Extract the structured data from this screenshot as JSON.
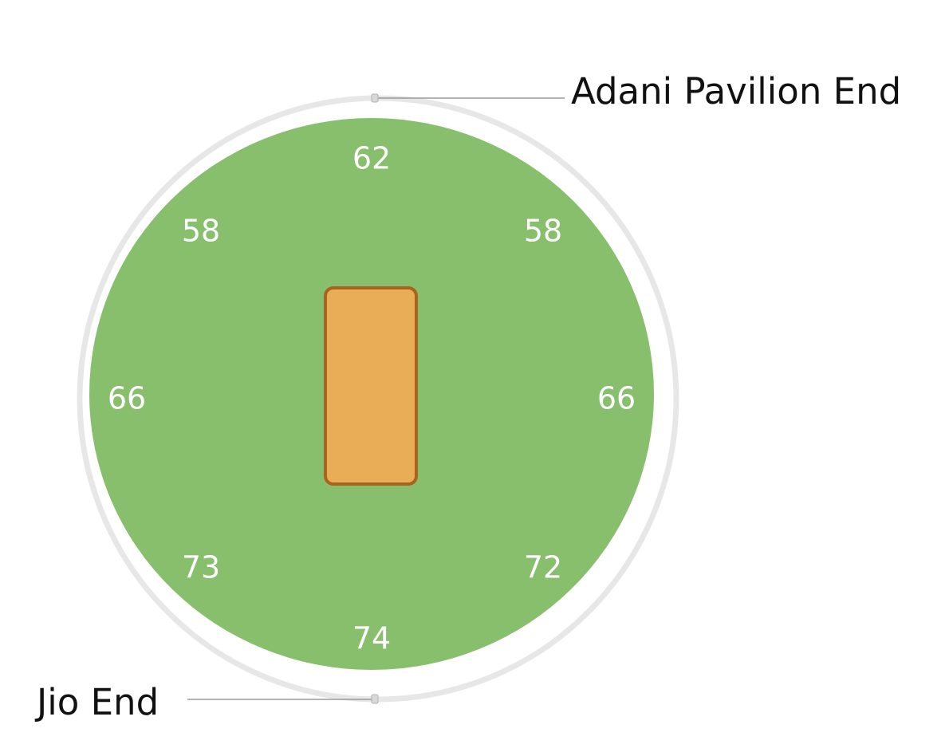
{
  "ends": {
    "top": "Adani Pavilion End",
    "bottom": "Jio End"
  },
  "boundaries": {
    "top": "62",
    "top_left": "58",
    "top_right": "58",
    "left": "66",
    "right": "66",
    "bottom_left": "73",
    "bottom_right": "72",
    "bottom": "74"
  },
  "colors": {
    "field": "#88bf6c",
    "pitch": "#e9ad58",
    "pitch_border": "#a8641c",
    "rope": "#e7e7e7",
    "label_text": "#ffffff",
    "end_text": "#111111"
  }
}
